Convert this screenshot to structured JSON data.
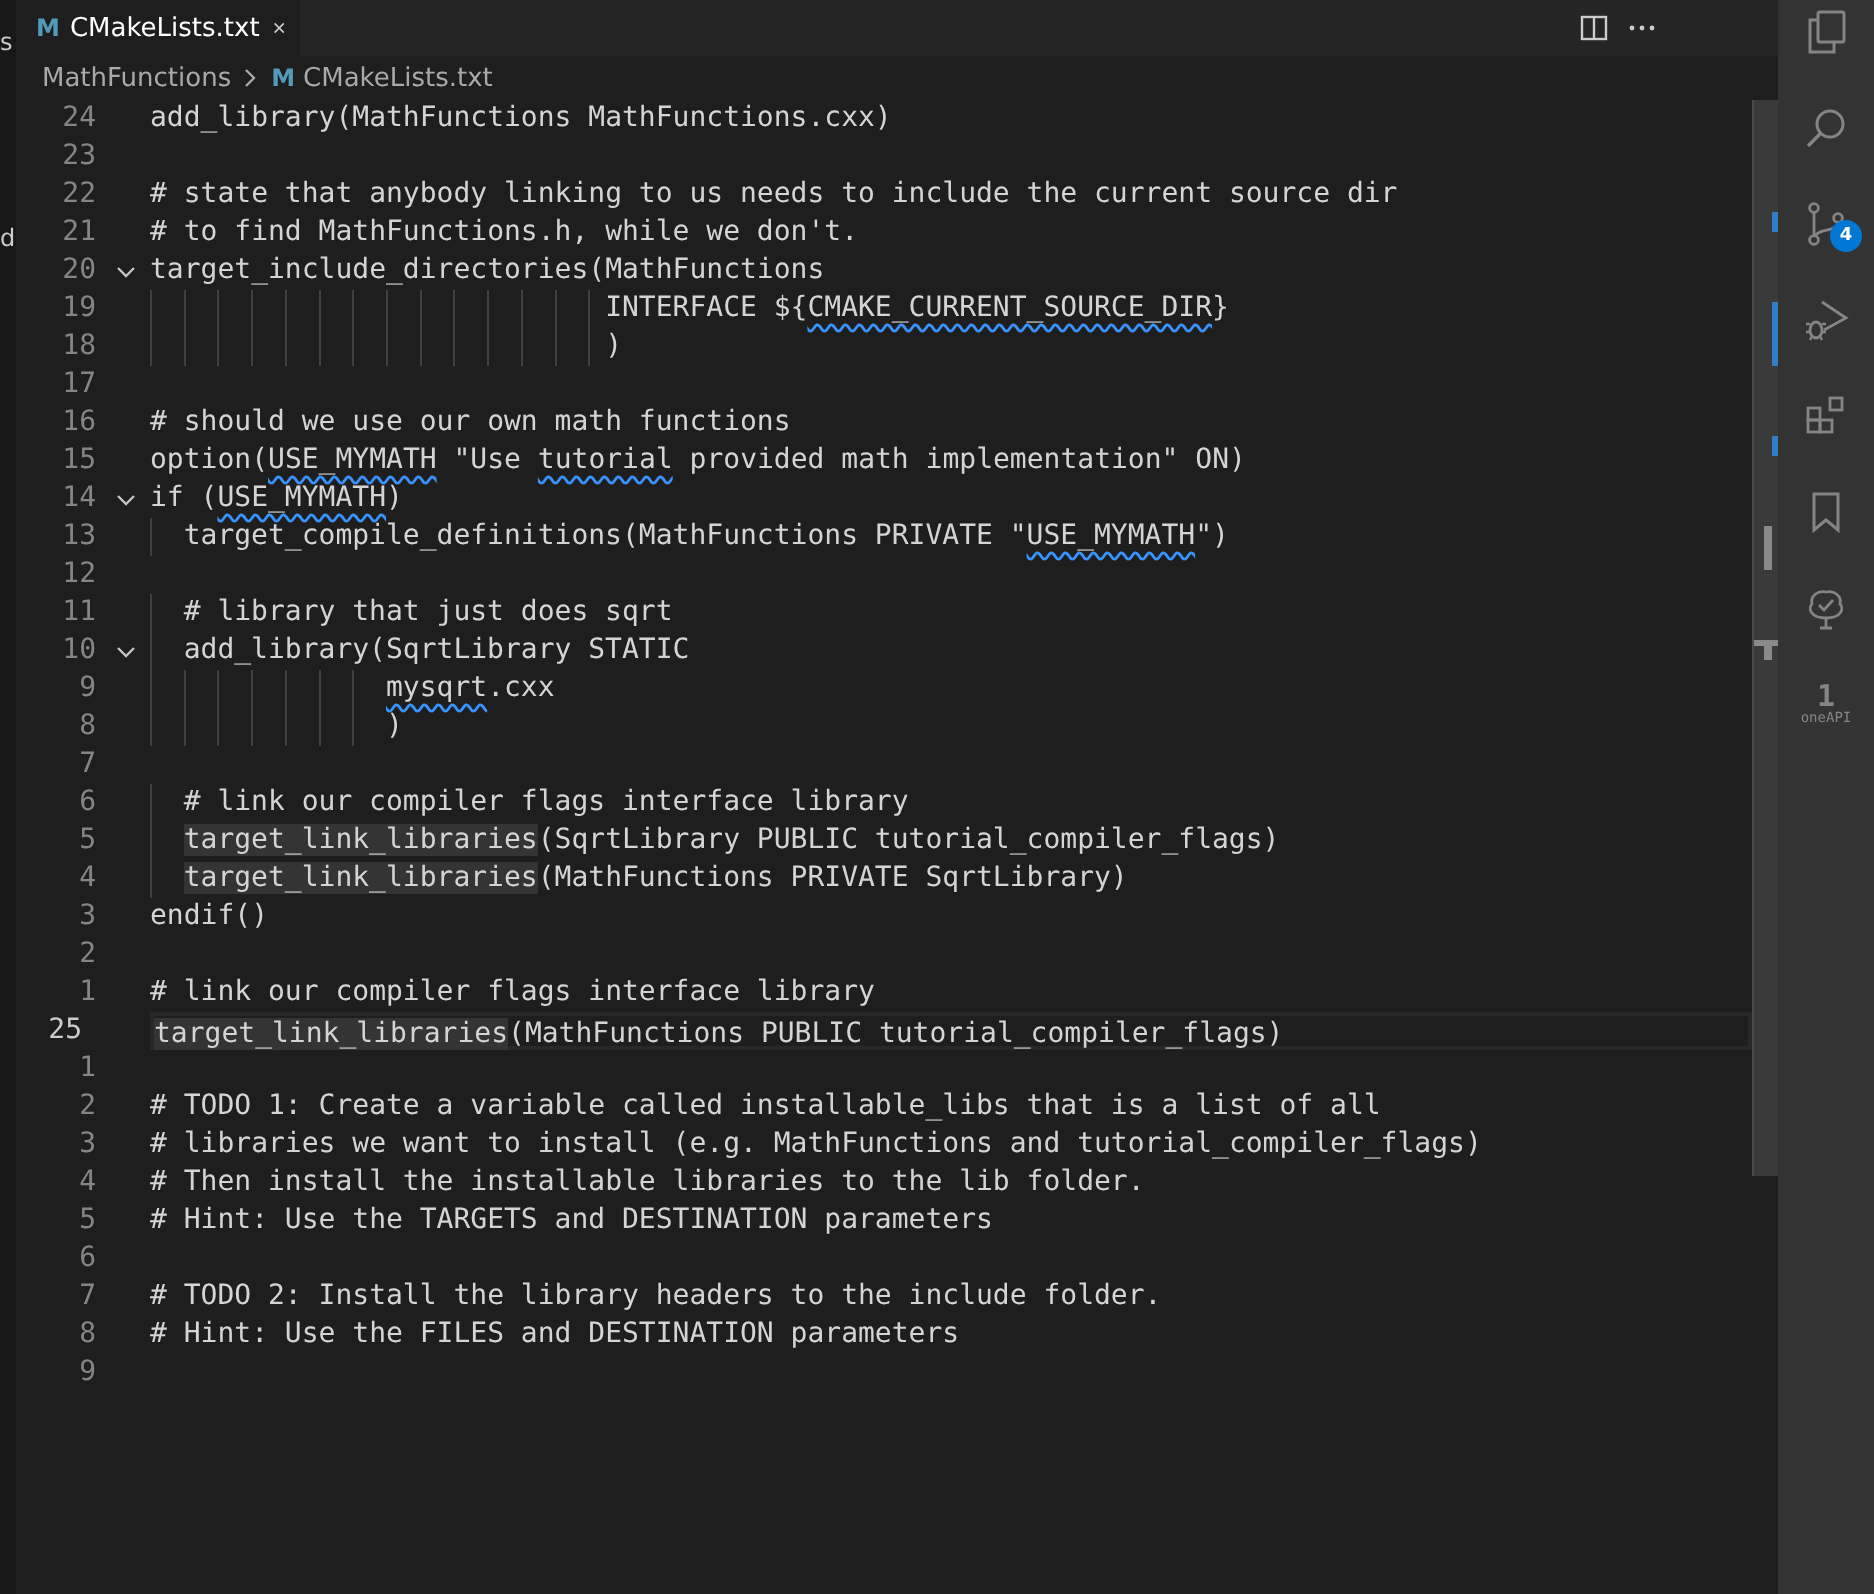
{
  "side_window": {
    "texts": [
      "s",
      "d"
    ]
  },
  "tabs": [
    {
      "icon_letter": "M",
      "label": "CMakeLists.txt",
      "selected": true
    }
  ],
  "breadcrumbs": [
    {
      "label": "MathFunctions"
    },
    {
      "icon_letter": "M",
      "label": "CMakeLists.txt"
    }
  ],
  "editor": {
    "lines": [
      {
        "number": "24",
        "fold": false,
        "current": false,
        "segments": [
          {
            "kind": "plain",
            "text": "add_library(MathFunctions MathFunctions.cxx)"
          }
        ]
      },
      {
        "number": "23",
        "fold": false,
        "current": false
      },
      {
        "number": "22",
        "fold": false,
        "current": false,
        "segments": [
          {
            "kind": "plain",
            "text": "# state that anybody linking to us needs to include the current source dir"
          }
        ]
      },
      {
        "number": "21",
        "fold": false,
        "current": false,
        "segments": [
          {
            "kind": "plain",
            "text": "# to find MathFunctions.h, while we don't."
          }
        ]
      },
      {
        "number": "20",
        "fold": true,
        "current": false,
        "segments": [
          {
            "kind": "plain",
            "text": "target_include_directories(MathFunctions"
          }
        ]
      },
      {
        "number": "19",
        "fold": false,
        "current": false,
        "segments": [
          {
            "kind": "plain",
            "text": "                           INTERFACE ${"
          },
          {
            "kind": "squiggle",
            "text": "CMAKE_CURRENT_SOURCE_DIR"
          },
          {
            "kind": "plain",
            "text": "}"
          }
        ]
      },
      {
        "number": "18",
        "fold": false,
        "current": false,
        "segments": [
          {
            "kind": "plain",
            "text": "                           )"
          }
        ]
      },
      {
        "number": "17",
        "fold": false,
        "current": false
      },
      {
        "number": "16",
        "fold": false,
        "current": false,
        "segments": [
          {
            "kind": "plain",
            "text": "# should we use our own math functions"
          }
        ]
      },
      {
        "number": "15",
        "fold": false,
        "current": false,
        "segments": [
          {
            "kind": "plain",
            "text": "option("
          },
          {
            "kind": "squiggle",
            "text": "USE_MYMATH"
          },
          {
            "kind": "plain",
            "text": " \"Use "
          },
          {
            "kind": "squiggle",
            "text": "tutorial"
          },
          {
            "kind": "plain",
            "text": " provided math implementation\" ON)"
          }
        ]
      },
      {
        "number": "14",
        "fold": true,
        "current": false,
        "segments": [
          {
            "kind": "plain",
            "text": "if ("
          },
          {
            "kind": "squiggle",
            "text": "USE_MYMATH"
          },
          {
            "kind": "plain",
            "text": ")"
          }
        ]
      },
      {
        "number": "13",
        "fold": false,
        "current": false,
        "segments": [
          {
            "kind": "plain",
            "text": "  target_compile_definitions(MathFunctions PRIVATE \""
          },
          {
            "kind": "squiggle",
            "text": "USE_MYMATH"
          },
          {
            "kind": "plain",
            "text": "\")"
          }
        ]
      },
      {
        "number": "12",
        "fold": false,
        "current": false
      },
      {
        "number": "11",
        "fold": false,
        "current": false,
        "segments": [
          {
            "kind": "plain",
            "text": "  # library that just does sqrt"
          }
        ]
      },
      {
        "number": "10",
        "fold": true,
        "current": false,
        "segments": [
          {
            "kind": "plain",
            "text": "  add_library(SqrtLibrary STATIC"
          }
        ]
      },
      {
        "number": "9",
        "fold": false,
        "current": false,
        "segments": [
          {
            "kind": "squiggle",
            "text": "              mysqrt"
          },
          {
            "kind": "plain",
            "text": ".cxx"
          }
        ]
      },
      {
        "number": "8",
        "fold": false,
        "current": false,
        "segments": [
          {
            "kind": "plain",
            "text": "              )"
          }
        ]
      },
      {
        "number": "7",
        "fold": false,
        "current": false
      },
      {
        "number": "6",
        "fold": false,
        "current": false,
        "segments": [
          {
            "kind": "plain",
            "text": "  # link our compiler flags interface library"
          }
        ]
      },
      {
        "number": "5",
        "fold": false,
        "current": false,
        "segments": [
          {
            "kind": "highlight",
            "text": "  target_link_libraries"
          },
          {
            "kind": "plain",
            "text": "(SqrtLibrary PUBLIC tutorial_compiler_flags)"
          }
        ]
      },
      {
        "number": "4",
        "fold": false,
        "current": false,
        "segments": [
          {
            "kind": "highlight",
            "text": "  target_link_libraries"
          },
          {
            "kind": "plain",
            "text": "(MathFunctions PRIVATE SqrtLibrary)"
          }
        ]
      },
      {
        "number": "3",
        "fold": false,
        "current": false,
        "segments": [
          {
            "kind": "plain",
            "text": "endif()"
          }
        ]
      },
      {
        "number": "2",
        "fold": false,
        "current": false
      },
      {
        "number": "1",
        "fold": false,
        "current": false,
        "segments": [
          {
            "kind": "plain",
            "text": "# link our compiler flags interface library"
          }
        ]
      },
      {
        "number": "25",
        "fold": false,
        "current": true,
        "segments": [
          {
            "kind": "highlight",
            "text": "target_link_libraries"
          },
          {
            "kind": "plain",
            "text": "(MathFunctions PUBLIC tutorial_compiler_flags)"
          }
        ]
      },
      {
        "number": "1",
        "fold": false,
        "current": false
      },
      {
        "number": "2",
        "fold": false,
        "current": false,
        "segments": [
          {
            "kind": "plain",
            "text": "# TODO 1: Create a variable called installable_libs that is a list of all"
          }
        ]
      },
      {
        "number": "3",
        "fold": false,
        "current": false,
        "segments": [
          {
            "kind": "plain",
            "text": "# libraries we want to install (e.g. MathFunctions and tutorial_compiler_flags)"
          }
        ]
      },
      {
        "number": "4",
        "fold": false,
        "current": false,
        "segments": [
          {
            "kind": "plain",
            "text": "# Then install the installable libraries to the lib folder."
          }
        ]
      },
      {
        "number": "5",
        "fold": false,
        "current": false,
        "segments": [
          {
            "kind": "plain",
            "text": "# Hint: Use the TARGETS and DESTINATION parameters"
          }
        ]
      },
      {
        "number": "6",
        "fold": false,
        "current": false
      },
      {
        "number": "7",
        "fold": false,
        "current": false,
        "segments": [
          {
            "kind": "plain",
            "text": "# TODO 2: Install the library headers to the include folder."
          }
        ]
      },
      {
        "number": "8",
        "fold": false,
        "current": false,
        "segments": [
          {
            "kind": "plain",
            "text": "# Hint: Use the FILES and DESTINATION parameters"
          }
        ]
      },
      {
        "number": "9",
        "fold": false,
        "current": false
      }
    ]
  },
  "activity_bar": {
    "items": [
      {
        "kind": "files"
      },
      {
        "kind": "search"
      },
      {
        "kind": "source-control",
        "badge": "4"
      },
      {
        "kind": "run-debug"
      },
      {
        "kind": "extensions"
      },
      {
        "kind": "bookmark"
      },
      {
        "kind": "testing"
      },
      {
        "kind": "oneapi",
        "glyph": "1",
        "caption": "oneAPI"
      }
    ]
  }
}
